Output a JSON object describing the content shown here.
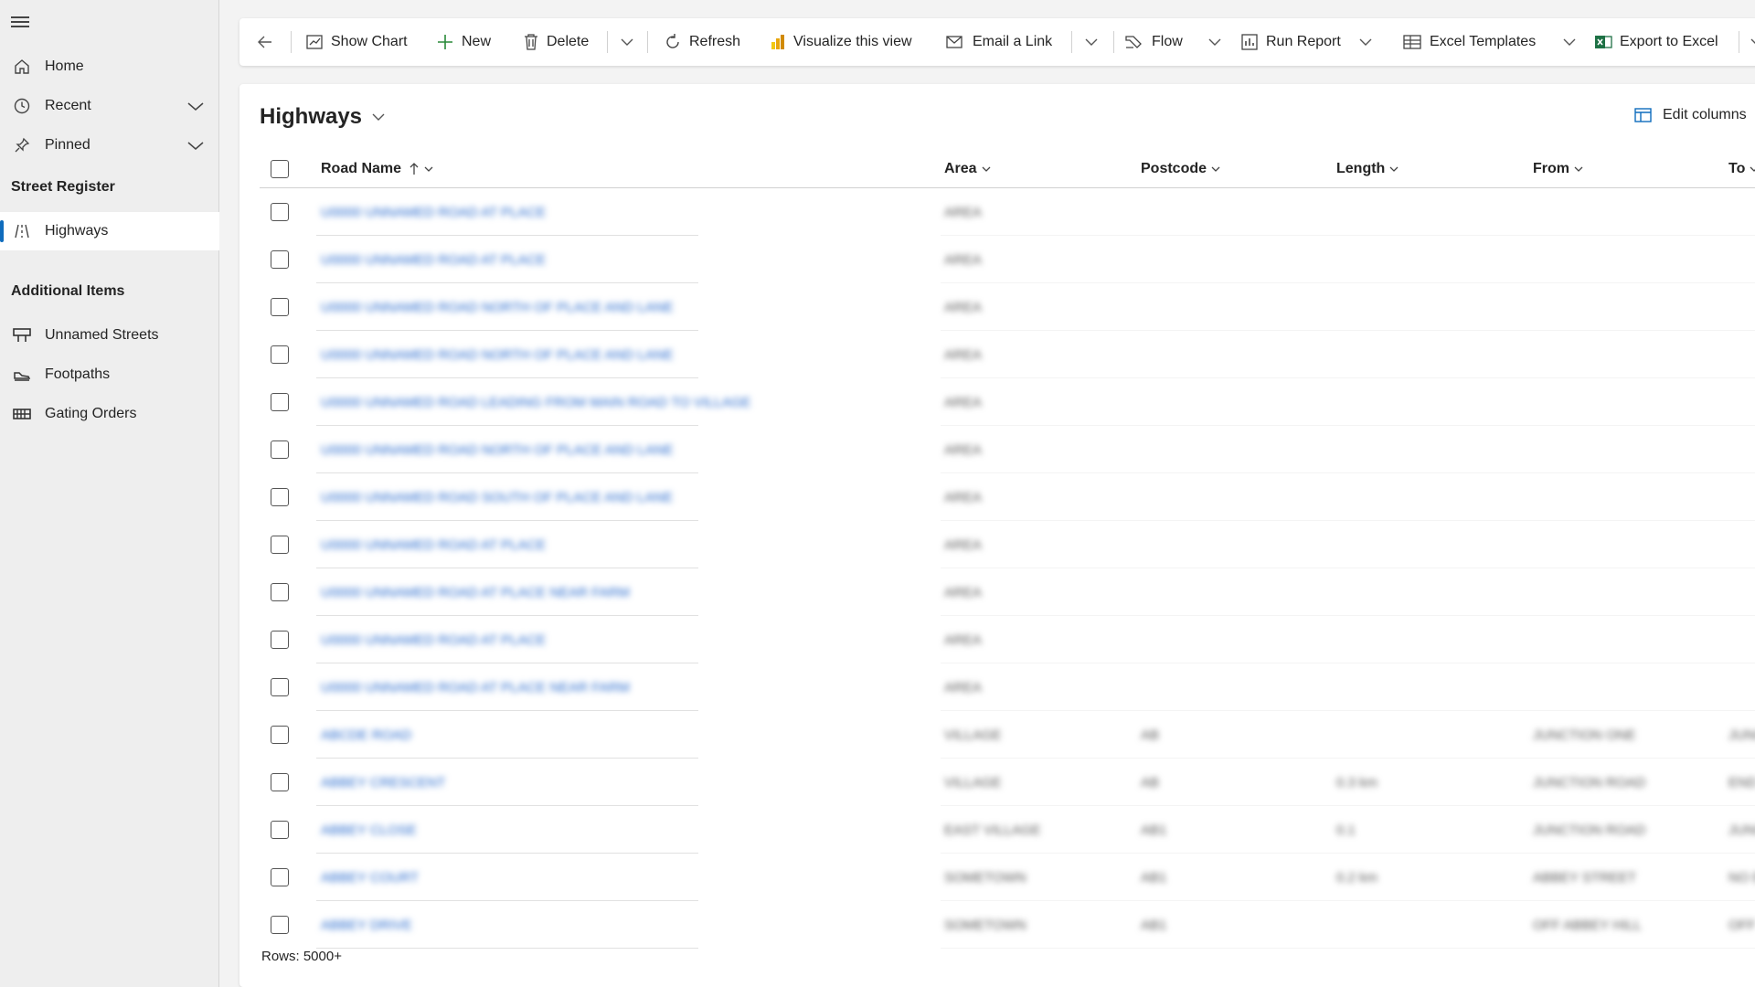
{
  "sidebar": {
    "home": "Home",
    "recent": "Recent",
    "pinned": "Pinned",
    "section_street": "Street Register",
    "highways": "Highways",
    "section_additional": "Additional Items",
    "unnamed_streets": "Unnamed Streets",
    "footpaths": "Footpaths",
    "gating_orders": "Gating Orders"
  },
  "toolbar": {
    "show_chart": "Show Chart",
    "new": "New",
    "delete": "Delete",
    "refresh": "Refresh",
    "visualize": "Visualize this view",
    "email_link": "Email a Link",
    "flow": "Flow",
    "run_report": "Run Report",
    "excel_templates": "Excel Templates",
    "export_excel": "Export to Excel"
  },
  "view": {
    "title": "Highways",
    "edit_columns": "Edit columns",
    "rows_label": "Rows: 5000+"
  },
  "columns": {
    "road_name": "Road Name",
    "area": "Area",
    "postcode": "Postcode",
    "length": "Length",
    "from": "From",
    "to": "To"
  },
  "rows": [
    {
      "name": "U0000 UNNAMED ROAD AT PLACE",
      "area": "AREA",
      "postcode": "",
      "length": "",
      "from": "",
      "to": ""
    },
    {
      "name": "U0000 UNNAMED ROAD AT PLACE",
      "area": "AREA",
      "postcode": "",
      "length": "",
      "from": "",
      "to": ""
    },
    {
      "name": "U0000 UNNAMED ROAD NORTH OF PLACE AND LANE",
      "area": "AREA",
      "postcode": "",
      "length": "",
      "from": "",
      "to": ""
    },
    {
      "name": "U0000 UNNAMED ROAD NORTH OF PLACE AND LANE",
      "area": "AREA",
      "postcode": "",
      "length": "",
      "from": "",
      "to": ""
    },
    {
      "name": "U0000 UNNAMED ROAD LEADING FROM MAIN ROAD TO VILLAGE",
      "area": "AREA",
      "postcode": "",
      "length": "",
      "from": "",
      "to": ""
    },
    {
      "name": "U0000 UNNAMED ROAD NORTH OF PLACE AND LANE",
      "area": "AREA",
      "postcode": "",
      "length": "",
      "from": "",
      "to": ""
    },
    {
      "name": "U0000 UNNAMED ROAD SOUTH OF PLACE AND LANE",
      "area": "AREA",
      "postcode": "",
      "length": "",
      "from": "",
      "to": ""
    },
    {
      "name": "U0000 UNNAMED ROAD AT PLACE",
      "area": "AREA",
      "postcode": "",
      "length": "",
      "from": "",
      "to": ""
    },
    {
      "name": "U0000 UNNAMED ROAD AT PLACE NEAR FARM",
      "area": "AREA",
      "postcode": "",
      "length": "",
      "from": "",
      "to": ""
    },
    {
      "name": "U0000 UNNAMED ROAD AT PLACE",
      "area": "AREA",
      "postcode": "",
      "length": "",
      "from": "",
      "to": ""
    },
    {
      "name": "U0000 UNNAMED ROAD AT PLACE NEAR FARM",
      "area": "AREA",
      "postcode": "",
      "length": "",
      "from": "",
      "to": ""
    },
    {
      "name": "ABCDE ROAD",
      "area": "VILLAGE",
      "postcode": "AB",
      "length": "",
      "from": "JUNCTION ONE",
      "to": "JUNCTION"
    },
    {
      "name": "ABBEY CRESCENT",
      "area": "VILLAGE",
      "postcode": "AB",
      "length": "0.3 km",
      "from": "JUNCTION ROAD",
      "to": "END"
    },
    {
      "name": "ABBEY CLOSE",
      "area": "EAST VILLAGE",
      "postcode": "AB1",
      "length": "0.1",
      "from": "JUNCTION ROAD",
      "to": "JUNCTION"
    },
    {
      "name": "ABBEY COURT",
      "area": "SOMETOWN",
      "postcode": "AB1",
      "length": "0.2 km",
      "from": "ABBEY STREET",
      "to": "NO EXIT"
    },
    {
      "name": "ABBEY DRIVE",
      "area": "SOMETOWN",
      "postcode": "AB1",
      "length": "",
      "from": "OFF ABBEY HILL",
      "to": "OFF"
    }
  ]
}
